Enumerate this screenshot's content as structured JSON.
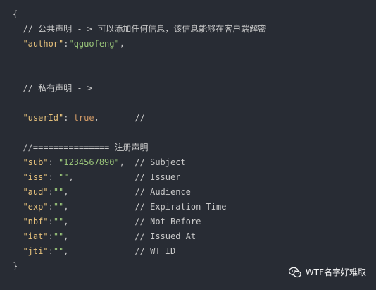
{
  "code": {
    "l01": {
      "brace_open": "{"
    },
    "l02": {
      "comment": "// 公共声明 - > 可以添加任何信息，该信息能够在客户端解密"
    },
    "l03": {
      "key": "\"author\"",
      "sep": ":",
      "value": "\"qguofeng\"",
      "trail": ","
    },
    "l06": {
      "comment": "// 私有声明 - >"
    },
    "l08": {
      "key": "\"userId\"",
      "sep": ": ",
      "value": "true",
      "trail": ",",
      "comment": "//"
    },
    "l10": {
      "comment": "//=============== 注册声明"
    },
    "l11": {
      "key": "\"sub\"",
      "sep": ": ",
      "value": "\"1234567890\"",
      "trail": ",",
      "comment": "// Subject"
    },
    "l12": {
      "key": "\"iss\"",
      "sep": ": ",
      "value": "\"\"",
      "trail": ",",
      "comment": "// Issuer"
    },
    "l13": {
      "key": "\"aud\"",
      "sep": ":",
      "value": "\"\"",
      "trail": ",",
      "comment": "// Audience"
    },
    "l14": {
      "key": "\"exp\"",
      "sep": ":",
      "value": "\"\"",
      "trail": ",",
      "comment": "// Expiration Time"
    },
    "l15": {
      "key": "\"nbf\"",
      "sep": ":",
      "value": "\"\"",
      "trail": ",",
      "comment": "// Not Before"
    },
    "l16": {
      "key": "\"iat\"",
      "sep": ":",
      "value": "\"\"",
      "trail": ",",
      "comment": "// Issued At"
    },
    "l17": {
      "key": "\"jti\"",
      "sep": ":",
      "value": "\"\"",
      "trail": ",",
      "comment": "// WT ID"
    },
    "l18": {
      "brace_close": "}"
    }
  },
  "watermark": {
    "text": "WTF名字好难取",
    "icon": "wechat-icon"
  },
  "colors": {
    "background": "#282c34",
    "key": "#e5c07b",
    "string": "#98c379",
    "boolean": "#d19a66",
    "comment": "#c9c9c9"
  }
}
